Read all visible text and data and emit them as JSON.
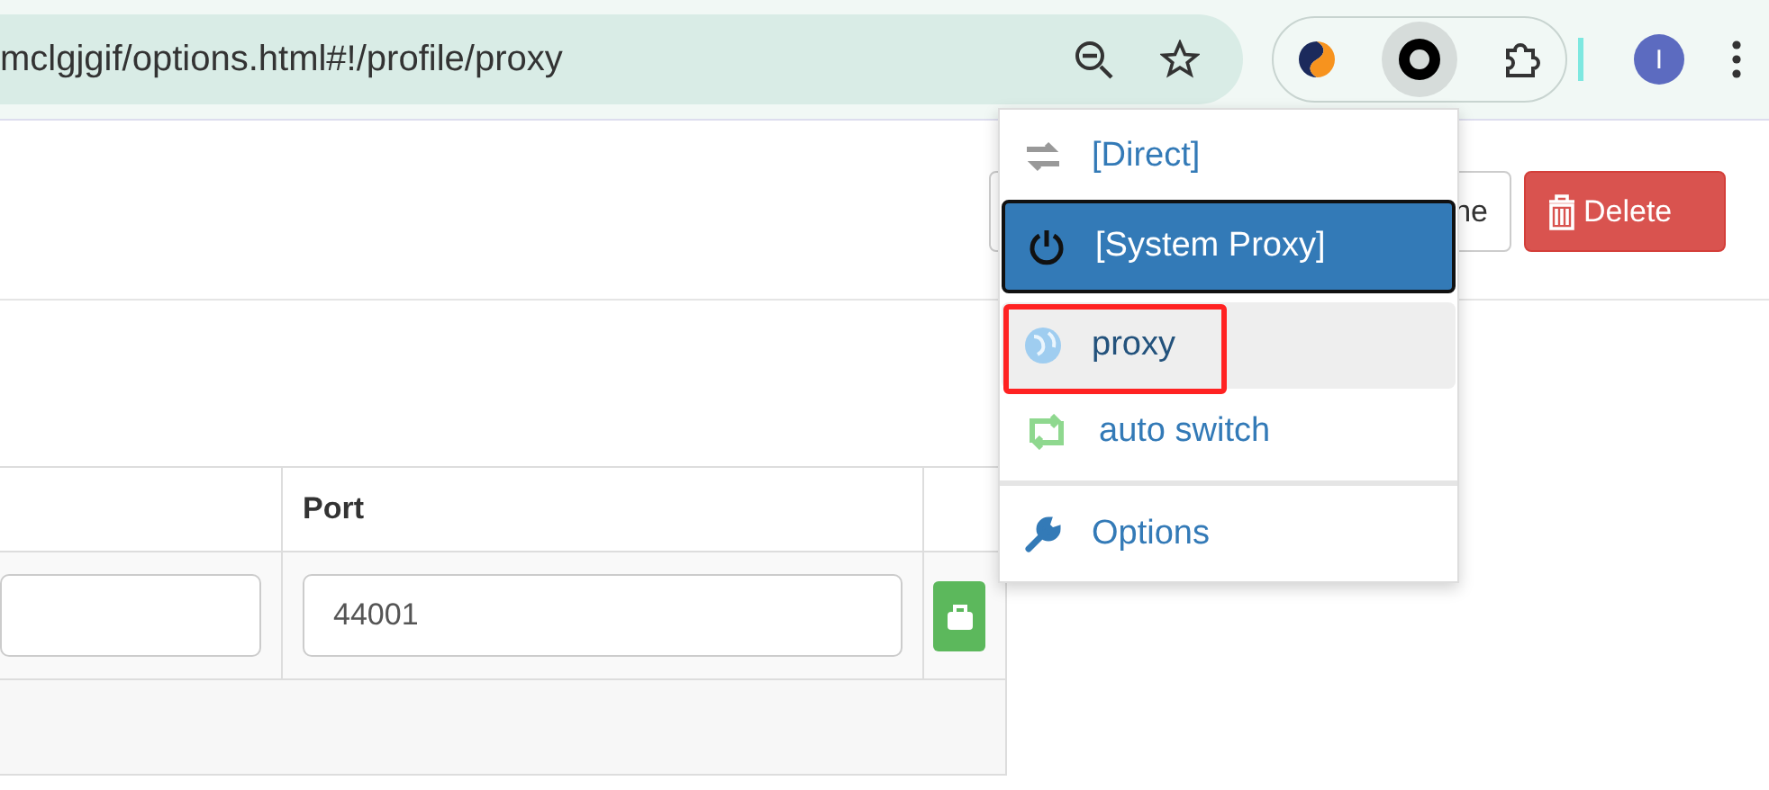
{
  "browser": {
    "url": "mclgjgif/options.html#!/profile/proxy",
    "avatar": "I"
  },
  "header": {
    "buttons": [
      {
        "label": "ne",
        "kind": "default"
      },
      {
        "label": "Delete",
        "kind": "danger"
      }
    ]
  },
  "table": {
    "columns": [
      {},
      {
        "label": "Port"
      },
      {}
    ],
    "rows": [
      {
        "port": "44001"
      }
    ]
  },
  "menu": {
    "items": [
      {
        "label": "[Direct]",
        "kind": "direct",
        "selected": false,
        "highlighted": false
      },
      {
        "label": "[System Proxy]",
        "kind": "system",
        "selected": true,
        "highlighted": false
      },
      {
        "label": "proxy",
        "kind": "proxy",
        "selected": false,
        "highlighted": true
      },
      {
        "label": "auto switch",
        "kind": "switch",
        "selected": false,
        "highlighted": false
      },
      {
        "label": "Options",
        "kind": "options",
        "selected": false,
        "highlighted": false
      }
    ]
  }
}
